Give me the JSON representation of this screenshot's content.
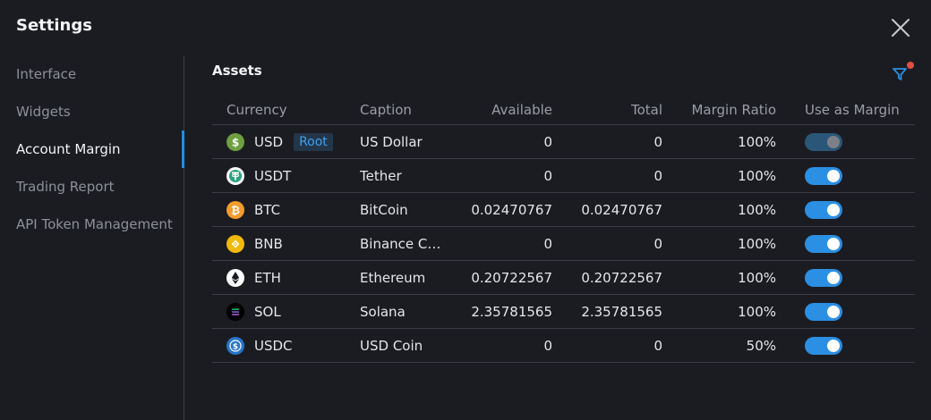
{
  "window": {
    "title": "Settings"
  },
  "sidebar": {
    "items": [
      {
        "label": "Interface",
        "active": false
      },
      {
        "label": "Widgets",
        "active": false
      },
      {
        "label": "Account Margin",
        "active": true
      },
      {
        "label": "Trading Report",
        "active": false
      },
      {
        "label": "API Token Management",
        "active": false
      }
    ]
  },
  "main": {
    "title": "Assets",
    "table": {
      "headers": {
        "currency": "Currency",
        "caption": "Caption",
        "available": "Available",
        "total": "Total",
        "margin_ratio": "Margin Ratio",
        "use_as_margin": "Use as Margin"
      },
      "rows": [
        {
          "currency": "USD",
          "badge": "Root",
          "caption": "US Dollar",
          "available": "0",
          "total": "0",
          "margin_ratio": "100%",
          "use_as_margin": true,
          "toggle_disabled": true,
          "icon": "usd-coin-icon",
          "icon_color": "#6ea03f"
        },
        {
          "currency": "USDT",
          "badge": "",
          "caption": "Tether",
          "available": "0",
          "total": "0",
          "margin_ratio": "100%",
          "use_as_margin": true,
          "toggle_disabled": false,
          "icon": "usdt-coin-icon",
          "icon_color": "#27a17c"
        },
        {
          "currency": "BTC",
          "badge": "",
          "caption": "BitCoin",
          "available": "0.02470767",
          "total": "0.02470767",
          "margin_ratio": "100%",
          "use_as_margin": true,
          "toggle_disabled": false,
          "icon": "btc-coin-icon",
          "icon_color": "#f39b2c"
        },
        {
          "currency": "BNB",
          "badge": "",
          "caption": "Binance C…",
          "available": "0",
          "total": "0",
          "margin_ratio": "100%",
          "use_as_margin": true,
          "toggle_disabled": false,
          "icon": "bnb-coin-icon",
          "icon_color": "#f0b90b"
        },
        {
          "currency": "ETH",
          "badge": "",
          "caption": "Ethereum",
          "available": "0.20722567",
          "total": "0.20722567",
          "margin_ratio": "100%",
          "use_as_margin": true,
          "toggle_disabled": false,
          "icon": "eth-coin-icon",
          "icon_color": "#ffffff"
        },
        {
          "currency": "SOL",
          "badge": "",
          "caption": "Solana",
          "available": "2.35781565",
          "total": "2.35781565",
          "margin_ratio": "100%",
          "use_as_margin": true,
          "toggle_disabled": false,
          "icon": "sol-coin-icon",
          "icon_color": "#000000"
        },
        {
          "currency": "USDC",
          "badge": "",
          "caption": "USD Coin",
          "available": "0",
          "total": "0",
          "margin_ratio": "50%",
          "use_as_margin": true,
          "toggle_disabled": false,
          "icon": "usdc-coin-icon",
          "icon_color": "#2775ca"
        }
      ]
    }
  },
  "colors": {
    "background": "#1b1c21",
    "accent": "#2b8fe3",
    "divider": "#3a3d45",
    "notification_dot": "#e2503f"
  }
}
